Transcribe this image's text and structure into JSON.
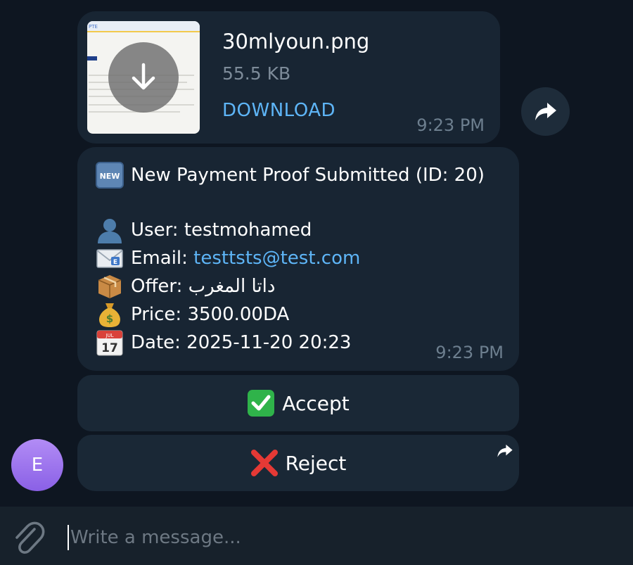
{
  "file_message": {
    "name": "30mlyoun.png",
    "size": "55.5 KB",
    "download_label": "DOWNLOAD",
    "time": "9:23 PM",
    "thumbnail_text": "PTE"
  },
  "text_message": {
    "title_emoji": "NEW",
    "title": "New Payment Proof Submitted (ID: 20)",
    "user_label": "User: testmohamed",
    "email_prefix": "Email: ",
    "email": "testtsts@test.com",
    "offer_label": "Offer: داتا المغرب",
    "price_label": "Price: 3500.00DA",
    "date_emoji": "JUL",
    "date_emoji_day": "17",
    "date_label": "Date: 2025-11-20 20:23",
    "time": "9:23 PM"
  },
  "keyboard": {
    "accept_label": "Accept",
    "reject_label": "Reject"
  },
  "sender": {
    "avatar_letter": "E"
  },
  "composer": {
    "placeholder": "Write a message..."
  },
  "colors": {
    "background": "#0e1621",
    "bubble": "#182533",
    "link": "#5eb5f7",
    "avatar": "#9a73ee",
    "accept_green": "#2fb34a",
    "reject_red": "#e53935"
  },
  "icons": {
    "download": "arrow-down-icon",
    "forward": "share-arrow-icon",
    "attach": "paperclip-icon",
    "new": "new-badge-icon",
    "user": "bust-silhouette-icon",
    "email": "envelope-icon",
    "offer": "package-icon",
    "price": "money-bag-icon",
    "date": "calendar-icon",
    "accept": "check-mark-button-icon",
    "reject": "cross-mark-icon"
  }
}
